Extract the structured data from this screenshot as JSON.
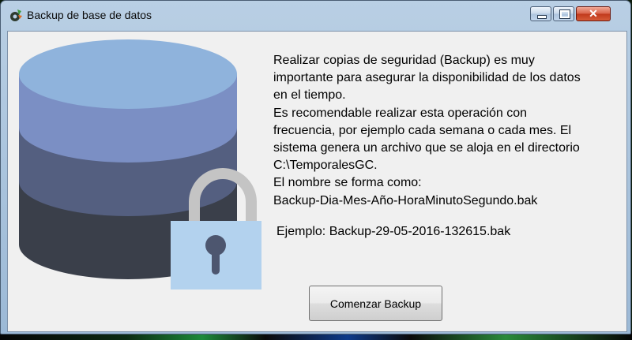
{
  "window": {
    "title": "Backup de base de datos",
    "close_glyph": "✕"
  },
  "description_lines": [
    "Realizar copias de seguridad (Backup) es muy",
    "importante para asegurar la disponibilidad de los datos",
    "en el tiempo.",
    "Es recomendable realizar esta operación con",
    "frecuencia, por ejemplo cada semana o cada mes. El",
    "sistema genera un archivo que se aloja en el directorio",
    "C:\\TemporalesGC.",
    "El nombre se forma como:",
    "Backup-Dia-Mes-Año-HoraMinutoSegundo.bak"
  ],
  "example_text": "Ejemplo: Backup-29-05-2016-132615.bak",
  "start_button_label": "Comenzar Backup",
  "icons": {
    "app": "gear-icon",
    "illustration": "database-icon",
    "lock": "padlock-icon"
  },
  "colors": {
    "db_top": "#8fb3dc",
    "db_layer1": "#7b8fc4",
    "db_layer2": "#545f80",
    "db_layer3": "#3a3f4a",
    "lock_body": "#b3d2ee",
    "lock_shackle": "#c4c4c4",
    "lock_keyhole": "#4d566f"
  }
}
